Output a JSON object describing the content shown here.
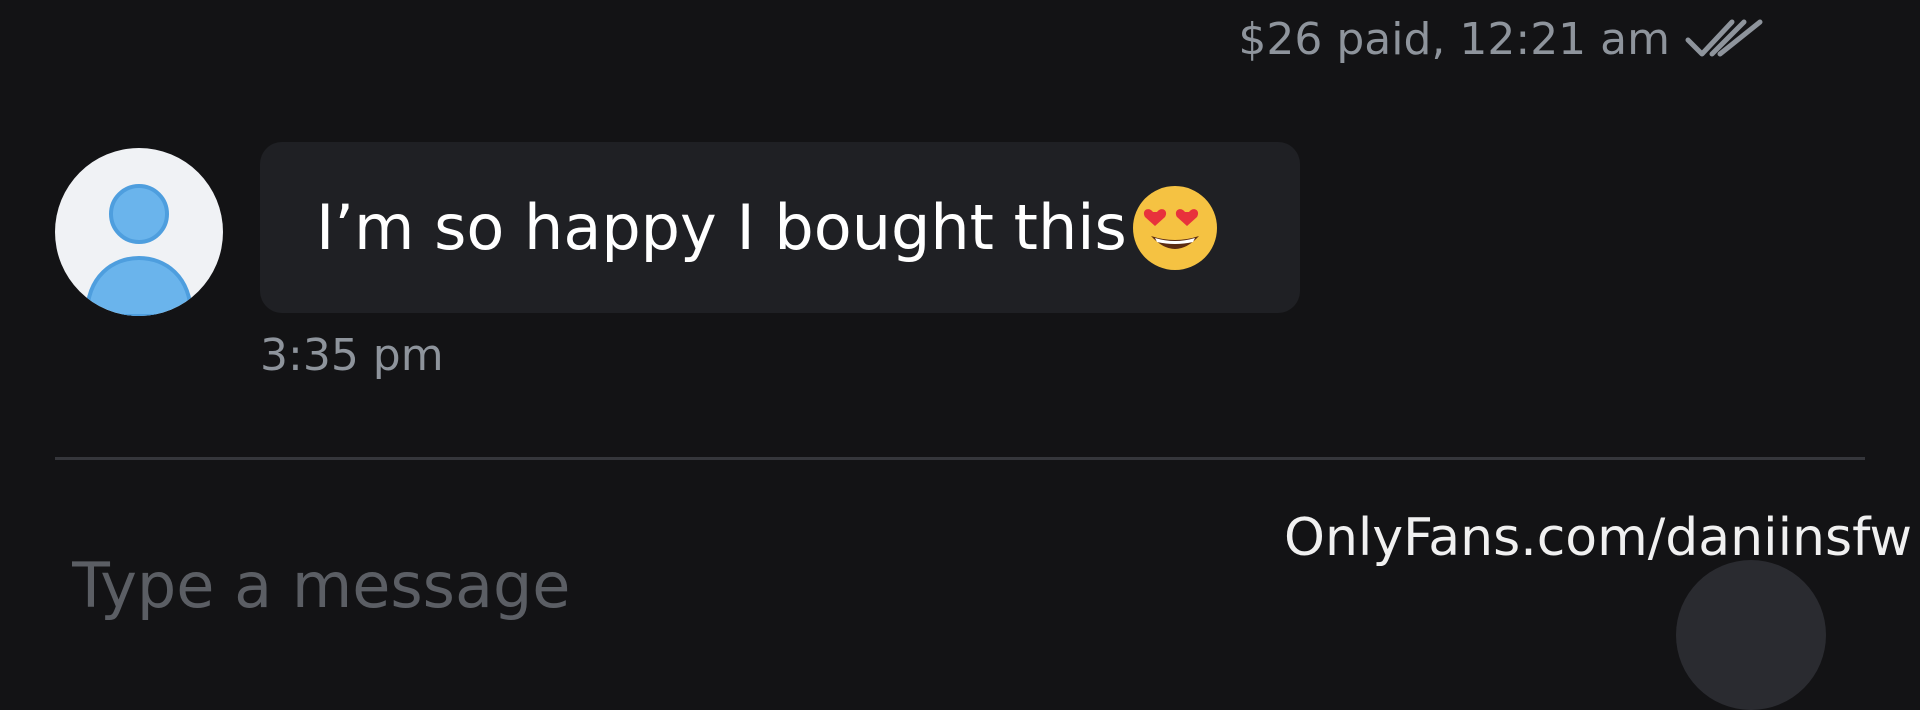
{
  "last_sent": {
    "status_text": "$26 paid, 12:21 am"
  },
  "message": {
    "text": "I’m so happy I bought this",
    "emoji": "heart-eyes-emoji",
    "time": "3:35 pm"
  },
  "composer": {
    "placeholder": "Type a message"
  },
  "watermark": {
    "text": "OnlyFans.com/daniinsfw"
  },
  "icons": {
    "read_receipt": "double-check-icon",
    "avatar": "default-user-avatar"
  },
  "colors": {
    "background": "#131315",
    "bubble": "#1f2024",
    "meta_text": "#8e949c",
    "avatar_blue": "#6ab4ec"
  }
}
